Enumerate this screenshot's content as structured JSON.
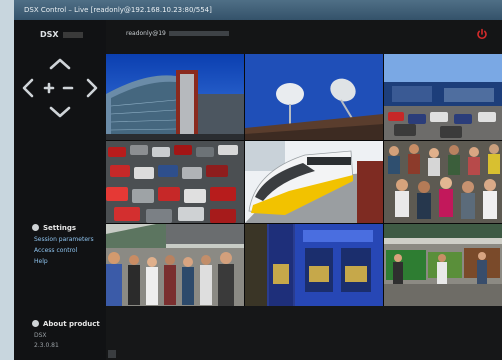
{
  "window": {
    "title": "DSX Control – Live [readonly@192.168.10.23:80/554]"
  },
  "sidebar": {
    "logo": "DSX",
    "settings": {
      "title": "Settings",
      "items": [
        {
          "label": "Session parameters"
        },
        {
          "label": "Access control"
        },
        {
          "label": "Help"
        }
      ]
    },
    "about": {
      "title": "About product",
      "product": "DSX",
      "version": "2.3.0.81"
    }
  },
  "header": {
    "user_prefix": "readonly@19",
    "power_icon": "power-icon"
  },
  "colors": {
    "accent_link": "#8ec3ee",
    "power": "#d52b2b"
  },
  "tiles": [
    {
      "name": "camera-tile-building"
    },
    {
      "name": "camera-tile-satellite-dishes"
    },
    {
      "name": "camera-tile-car-park-terminal"
    },
    {
      "name": "camera-tile-parking-lot"
    },
    {
      "name": "camera-tile-train"
    },
    {
      "name": "camera-tile-crowd"
    },
    {
      "name": "camera-tile-street"
    },
    {
      "name": "camera-tile-atm"
    },
    {
      "name": "camera-tile-market"
    }
  ]
}
